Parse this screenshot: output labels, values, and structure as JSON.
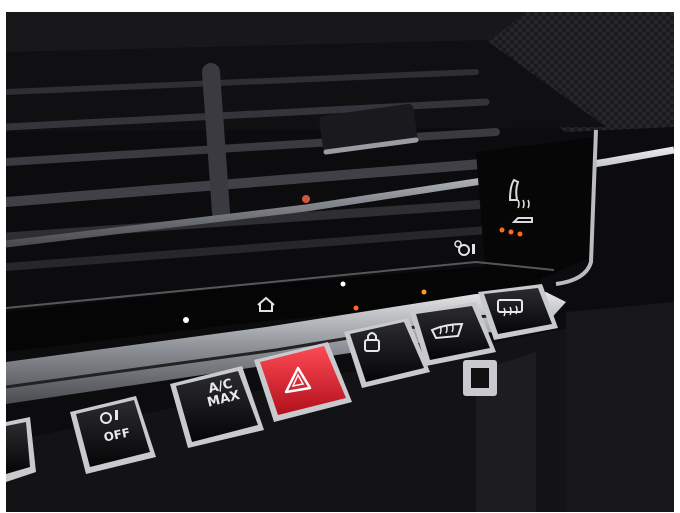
{
  "scene": {
    "buttons": {
      "fan_off": {
        "label": "OFF",
        "icon": "fan-icon"
      },
      "ac_max": {
        "label": "A/C\nMAX",
        "icon": "ac-max-icon"
      },
      "hazard": {
        "icon": "hazard-triangle-icon",
        "color": "#e3202e"
      },
      "lock": {
        "icon": "padlock-icon"
      },
      "front_defrost": {
        "icon": "windshield-defrost-icon"
      },
      "rear_defrost": {
        "icon": "rear-window-defrost-icon"
      }
    },
    "touch_bar": {
      "home_icon": "home-icon",
      "fan_icon": "fan-icon"
    },
    "seat_heater_icon": "heated-seat-icon",
    "colors": {
      "panel": "#0b0b0d",
      "chrome": "#b9bcc0",
      "indicator_orange": "#ff6a1a",
      "hazard_red": "#e3202e"
    }
  }
}
